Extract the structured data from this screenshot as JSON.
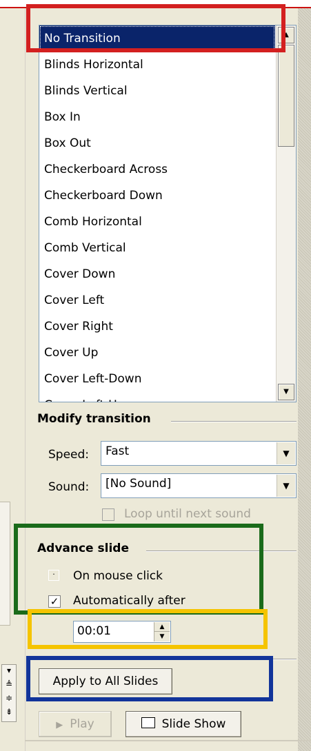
{
  "transitions": {
    "items": [
      "No Transition",
      "Blinds Horizontal",
      "Blinds Vertical",
      "Box In",
      "Box Out",
      "Checkerboard Across",
      "Checkerboard Down",
      "Comb Horizontal",
      "Comb Vertical",
      "Cover Down",
      "Cover Left",
      "Cover Right",
      "Cover Up",
      "Cover Left-Down",
      "Cover Left-Up"
    ],
    "selected": "No Transition"
  },
  "modify": {
    "title": "Modify transition",
    "speed_label": "Speed:",
    "speed_value": "Fast",
    "sound_label": "Sound:",
    "sound_value": "[No Sound]",
    "loop_label": "Loop until next sound",
    "loop_checked": false,
    "loop_enabled": false
  },
  "advance": {
    "title": "Advance slide",
    "mouse_click_label": "On mouse click",
    "mouse_click_checked": false,
    "auto_label": "Automatically after",
    "auto_checked": true,
    "auto_time": "00:01"
  },
  "buttons": {
    "apply_all": "Apply to All Slides",
    "play": "Play",
    "slide_show": "Slide Show"
  },
  "icons": {
    "list_up": "scroll-up-arrow",
    "list_down": "scroll-down-arrow",
    "combo": "dropdown-arrow",
    "play": "play-triangle",
    "slide_show": "projector-screen"
  },
  "highlight_colors": {
    "red": "#d32020",
    "green": "#1a6b1a",
    "yellow": "#f5c400",
    "blue": "#12349a"
  }
}
